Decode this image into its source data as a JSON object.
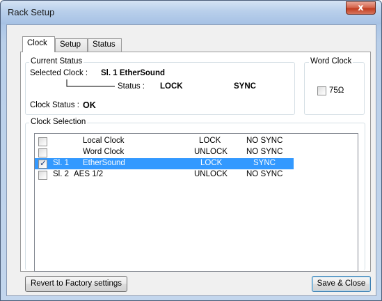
{
  "window": {
    "title": "Rack Setup",
    "close_glyph": "x"
  },
  "tabs": [
    {
      "label": "Clock",
      "active": true
    },
    {
      "label": "Setup",
      "active": false
    },
    {
      "label": "Status",
      "active": false
    }
  ],
  "current_status": {
    "group_label": "Current Status",
    "selected_clock_label": "Selected Clock :",
    "selected_clock_value": "Sl. 1 EtherSound",
    "status_label": "Status :",
    "lock_value": "LOCK",
    "sync_value": "SYNC",
    "clock_status_label": "Clock Status :",
    "clock_status_value": "OK"
  },
  "word_clock": {
    "group_label": "Word Clock",
    "checkbox_label": "75Ω",
    "checked": false
  },
  "clock_selection": {
    "group_label": "Clock Selection",
    "rows": [
      {
        "slot": "",
        "name": "Local Clock",
        "lock": "LOCK",
        "sync": "NO SYNC",
        "checked": false,
        "selected": false
      },
      {
        "slot": "",
        "name": "Word Clock",
        "lock": "UNLOCK",
        "sync": "NO SYNC",
        "checked": false,
        "selected": false
      },
      {
        "slot": "Sl. 1",
        "name": "EtherSound",
        "lock": "LOCK",
        "sync": "SYNC",
        "checked": true,
        "selected": true
      },
      {
        "slot": "Sl. 2",
        "name": "AES 1/2",
        "lock": "UNLOCK",
        "sync": "NO SYNC",
        "checked": false,
        "selected": false
      }
    ]
  },
  "buttons": {
    "revert_label": "Revert to Factory settings",
    "save_close_label": "Save & Close"
  },
  "colors": {
    "selection": "#3399ff",
    "close_button": "#c13d21"
  }
}
